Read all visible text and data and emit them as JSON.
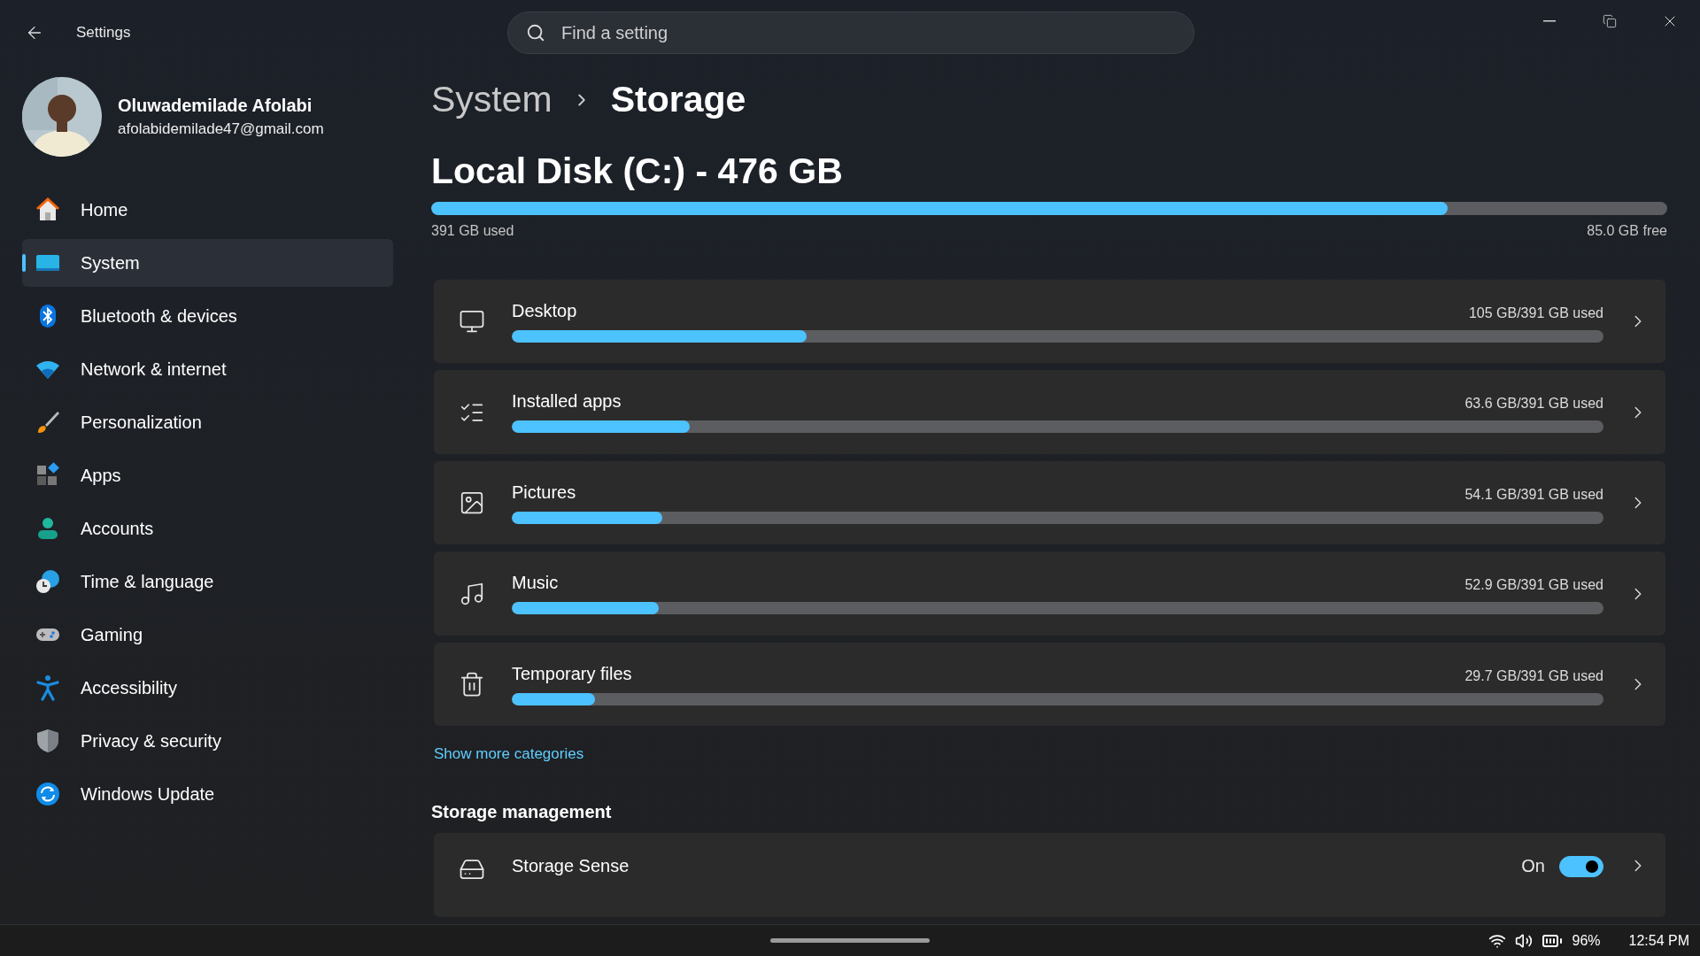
{
  "title_bar": {
    "title": "Settings"
  },
  "search": {
    "placeholder": "Find a setting"
  },
  "user": {
    "name": "Oluwademilade Afolabi",
    "email": "afolabidemilade47@gmail.com"
  },
  "nav": [
    {
      "label": "Home",
      "kind": "home",
      "selected": false
    },
    {
      "label": "System",
      "kind": "system",
      "selected": true
    },
    {
      "label": "Bluetooth & devices",
      "kind": "bluetooth",
      "selected": false
    },
    {
      "label": "Network & internet",
      "kind": "network",
      "selected": false
    },
    {
      "label": "Personalization",
      "kind": "brush",
      "selected": false
    },
    {
      "label": "Apps",
      "kind": "apps",
      "selected": false
    },
    {
      "label": "Accounts",
      "kind": "accounts",
      "selected": false
    },
    {
      "label": "Time & language",
      "kind": "time",
      "selected": false
    },
    {
      "label": "Gaming",
      "kind": "gaming",
      "selected": false
    },
    {
      "label": "Accessibility",
      "kind": "accessibility",
      "selected": false
    },
    {
      "label": "Privacy & security",
      "kind": "privacy",
      "selected": false
    },
    {
      "label": "Windows Update",
      "kind": "update",
      "selected": false
    }
  ],
  "breadcrumb": [
    "System",
    "Storage"
  ],
  "disk": {
    "title": "Local Disk (C:) - 476 GB",
    "level": 0.822,
    "used": "391 GB used",
    "free": "85.0 GB free"
  },
  "categories": [
    {
      "label": "Desktop",
      "kind": "desktop",
      "usage": "105 GB/391 GB used",
      "level": 0.27
    },
    {
      "label": "Installed apps",
      "kind": "apps",
      "usage": "63.6 GB/391 GB used",
      "level": 0.163
    },
    {
      "label": "Pictures",
      "kind": "pictures",
      "usage": "54.1 GB/391 GB used",
      "level": 0.138
    },
    {
      "label": "Music",
      "kind": "music",
      "usage": "52.9 GB/391 GB used",
      "level": 0.135
    },
    {
      "label": "Temporary files",
      "kind": "temp",
      "usage": "29.7 GB/391 GB used",
      "level": 0.076
    }
  ],
  "show_more": "Show more categories",
  "storage_management": {
    "heading": "Storage management",
    "items": [
      {
        "label": "Storage Sense",
        "state_label": "On",
        "on": true
      }
    ]
  },
  "taskbar": {
    "battery": "96%",
    "time": "12:54 PM"
  }
}
